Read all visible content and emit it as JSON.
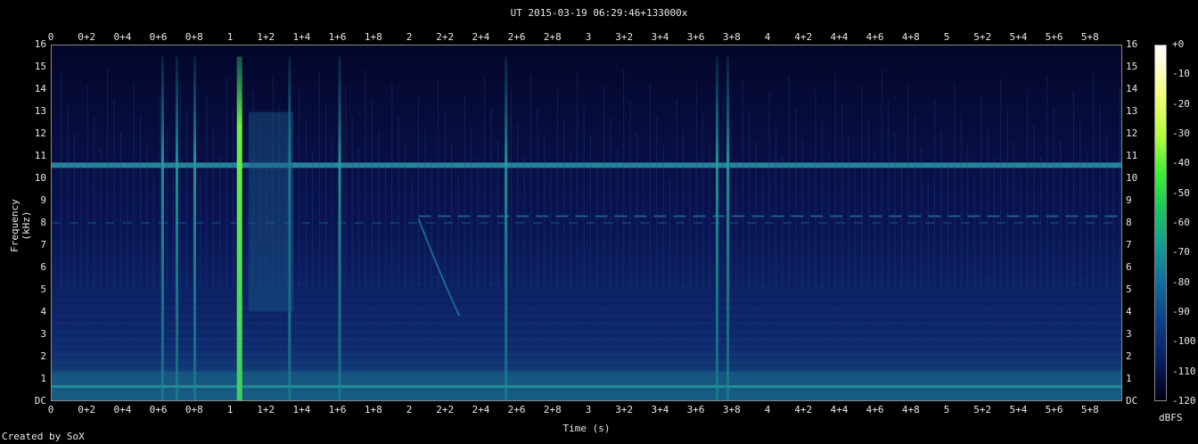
{
  "title": "UT 2015-03-19 06:29:46+133000x",
  "credit": "Created by SoX",
  "chart_data": {
    "type": "heatmap",
    "xlabel": "Time (s)",
    "ylabel": "Frequency (kHz)",
    "xlim": [
      0,
      5.98
    ],
    "ylim": [
      0,
      16
    ],
    "x_ticks": [
      "0",
      "0+2",
      "0+4",
      "0+6",
      "0+8",
      "1",
      "1+2",
      "1+4",
      "1+6",
      "1+8",
      "2",
      "2+2",
      "2+4",
      "2+6",
      "2+8",
      "3",
      "3+2",
      "3+4",
      "3+6",
      "3+8",
      "4",
      "4+2",
      "4+4",
      "4+6",
      "4+8",
      "5",
      "5+2",
      "5+4",
      "5+6",
      "5+8"
    ],
    "y_ticks": [
      "DC",
      "1",
      "2",
      "3",
      "4",
      "5",
      "6",
      "7",
      "8",
      "9",
      "10",
      "11",
      "12",
      "13",
      "14",
      "15",
      "16"
    ],
    "colorbar": {
      "unit": "dBFS",
      "ticks": [
        "+0",
        "-10",
        "-20",
        "-30",
        "-40",
        "-50",
        "-60",
        "-70",
        "-80",
        "-90",
        "-100",
        "-110",
        "-120"
      ],
      "range": [
        -120,
        0
      ]
    },
    "features": {
      "horizontal_band_khz": 10.6,
      "dashed_band_khz": 8.3,
      "strong_transient_s": 1.05,
      "vertical_transients_s": [
        0.62,
        0.7,
        0.8,
        1.05,
        1.33,
        1.61,
        2.54,
        3.72,
        3.78
      ]
    }
  }
}
